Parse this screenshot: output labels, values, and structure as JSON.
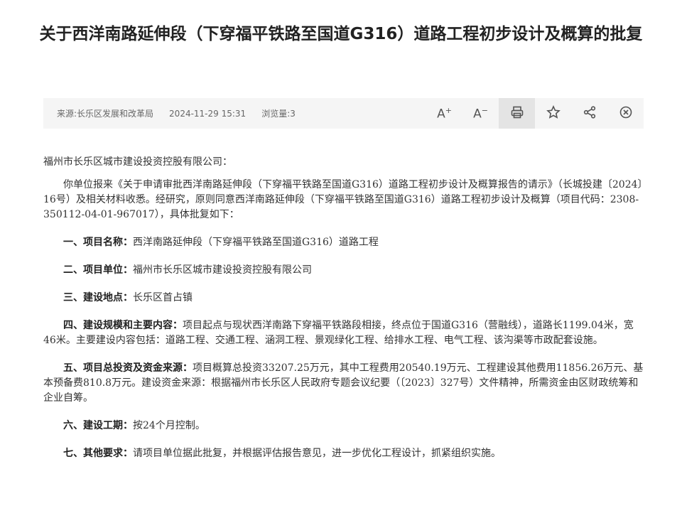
{
  "title": "关于西洋南路延伸段（下穿福平铁路至国道G316）道路工程初步设计及概算的批复",
  "info": {
    "source": "来源:长乐区发展和改革局",
    "date": "2024-11-29 15:31",
    "views": "浏览量:3"
  },
  "tools": {
    "increase_font": "A",
    "decrease_font": "A",
    "print_icon": "printer-icon",
    "favorite_icon": "star-icon",
    "share_icon": "share-icon",
    "close_icon": "close-icon"
  },
  "article": {
    "addressee": "福州市长乐区城市建设投资控股有限公司：",
    "intro": "你单位报来《关于申请审批西洋南路延伸段（下穿福平铁路至国道G316）道路工程初步设计及概算报告的请示》（长城投建〔2024〕16号）及相关材料收悉。经研究，原则同意西洋南路延伸段（下穿福平铁路至国道G316）道路工程初步设计及概算（项目代码：2308-350112-04-01-967017），具体批复如下：",
    "sections": [
      {
        "label": "一、项目名称：",
        "text": "西洋南路延伸段（下穿福平铁路至国道G316）道路工程"
      },
      {
        "label": "二、项目单位：",
        "text": "福州市长乐区城市建设投资控股有限公司"
      },
      {
        "label": "三、建设地点：",
        "text": "长乐区首占镇"
      },
      {
        "label": "四、建设规模和主要内容：",
        "text": "项目起点与现状西洋南路下穿福平铁路段相接，终点位于国道G316（营融线），道路长1199.04米，宽46米。主要建设内容包括：道路工程、交通工程、涵洞工程、景观绿化工程、给排水工程、电气工程、该沟渠等市政配套设施。"
      },
      {
        "label": "五、项目总投资及资金来源：",
        "text": "项目概算总投资33207.25万元，其中工程费用20540.19万元、工程建设其他费用11856.26万元、基本预备费810.8万元。建设资金来源：根据福州市长乐区人民政府专题会议纪要（〔2023〕327号）文件精神，所需资金由区财政统筹和企业自筹。"
      },
      {
        "label": "六、建设工期：",
        "text": "按24个月控制。"
      },
      {
        "label": "七、其他要求：",
        "text": "请项目单位据此批复，并根据评估报告意见，进一步优化工程设计，抓紧组织实施。"
      }
    ]
  }
}
